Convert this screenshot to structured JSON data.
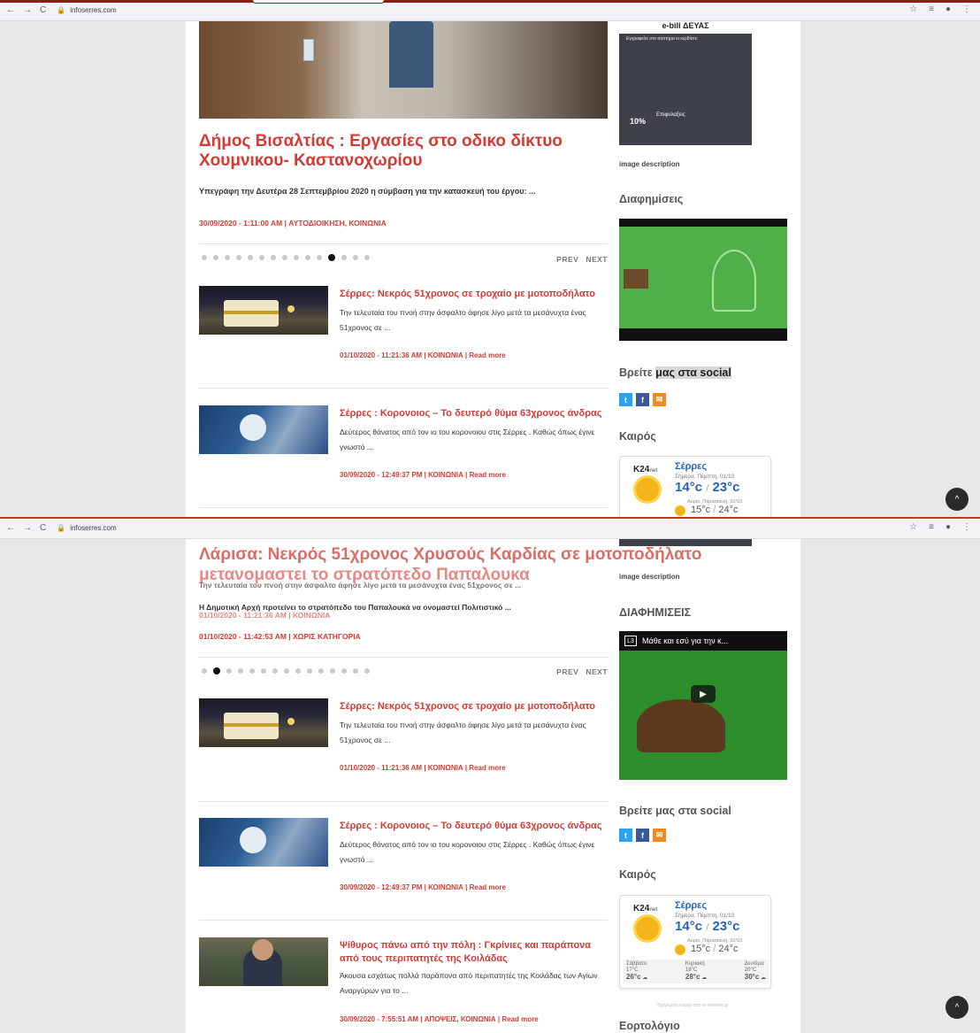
{
  "browser": {
    "url": "infoserres.com",
    "nav_back": "←",
    "nav_forward": "→",
    "nav_reload": "C",
    "lock": "🔒",
    "star": "☆",
    "reader": "≡",
    "account": "●",
    "menu": "⋮"
  },
  "shot1": {
    "lead": {
      "title": "Δήμος Βισαλτίας : Εργασίες στο οδικο δίκτυο Χουμνικου- Καστανοχωρίου",
      "summary": "Υπεγράφη την Δευτέρα 28 Σεπτεμβρίου 2020 η σύμβαση για την κατασκευή του έργου: ...",
      "meta": "30/09/2020 - 1:11:00 AM | ΑΥΤΟΔΙΟΙΚΗΣΗ, ΚΟΙΝΩΝΙΑ"
    },
    "slider": {
      "prev": "PREV",
      "next": "NEXT",
      "dot_count": 15,
      "active": 11
    },
    "items": [
      {
        "title": "Σέρρες: Νεκρός 51χρονος σε τροχαίο με μοτοποδήλατο",
        "summary": "Την τελευταία του πνοή στην άσφαλτο άφησε λίγο μετά τα μεσάνυχτα ένας 51χρονος σε ...",
        "meta": "01/10/2020 - 11:21:36 AM | ΚΟΙΝΩΝΙΑ | Read more"
      },
      {
        "title": "Σέρρες : Κορονοιος – Το δευτερό θύμα 63χρονος άνδρας",
        "summary": "Δεύτερος θάνατος από τον ιο του κορονοιου στις Σέρρες . Καθώς όπως έγινε γνωστό ...",
        "meta": "30/09/2020 - 12:49:37 PM | ΚΟΙΝΩΝΙΑ | Read more"
      }
    ],
    "sidebar": {
      "ebill_head": "e-bill ΔΕΥΑΣ",
      "ebill_sub": "Εγγραφείτε στο σύστημα κι κερδίστε:",
      "ebill_pct": "10%",
      "ebill_benefit": "Επιφυλαξεις",
      "image_description": "image description",
      "ads_heading": "Διαφημίσεις",
      "social_heading_a": "Βρείτε",
      "social_heading_b": "μας στα social",
      "weather_heading": "Καιρός"
    }
  },
  "shot2": {
    "ghost_a": "Λάρισα: Νεκρός 51χρονος Χρυσούς Καρδίας σε μοτοποδήλατο",
    "ghost_b": "μετανομαστει το στρατόπεδο Παπαλουκα",
    "ghost_c": "Την τελευταία του πνοή στην άσφαλτο άφησε λίγο μετά τα μεσάνυχτα ένας 51χρονος σε ...",
    "ghost_d": "Η Δημοτική Αρχή προτείνει το στρατόπεδο του Παπαλουκά να ονομαστεί Πολιτιστικό ...",
    "ghost_e": "01/10/2020 - 11:21:36 AM | ΚΟΙΝΩΝΙΑ",
    "ghost_meta": "01/10/2020 - 11:42:53 AM | ΧΩΡΙΣ ΚΑΤΗΓΟΡΙΑ",
    "slider": {
      "prev": "PREV",
      "next": "NEXT",
      "dot_count": 15,
      "active": 1
    },
    "items": [
      {
        "title": "Σέρρες: Νεκρός 51χρονος σε τροχαίο με μοτοποδήλατο",
        "summary": "Την τελευταία του πνοή στην άσφαλτο άφησε λίγο μετά τα μεσάνυχτα ένας 51χρονος σε ...",
        "meta": "01/10/2020 - 11:21:36 AM | ΚΟΙΝΩΝΙΑ | Read more"
      },
      {
        "title": "Σέρρες : Κορονοιος – Το δευτερό θύμα 63χρονος άνδρας",
        "summary": "Δεύτερος θάνατος από τον ιο του κορονοιου στις Σέρρες . Καθώς όπως έγινε γνωστό ...",
        "meta": "30/09/2020 - 12:49:37 PM | ΚΟΙΝΩΝΙΑ | Read more"
      },
      {
        "title": "Ψίθυρος πάνω από την πόλη : Γκρίνιες και παράπονα από τους περιπατητές της Κοιλάδας",
        "summary": "Άκουσα εσχάτως πολλά παράπονα από περιπατητές της Κοιλάδας των Αγίων Αναργύρων για το ...",
        "meta": "30/09/2020 - 7:55:51 AM | ΑΠΟΨΕΙΣ, ΚΟΙΝΩΝΙΑ | Read more"
      }
    ],
    "sidebar": {
      "image_description": "image description",
      "ads_heading": "ΔΙΑΦΗΜΙΣΕΙΣ",
      "video_title": "Μάθε και εσύ για την κ...",
      "video_logo": "L3",
      "social_heading": "Βρείτε μας στα social",
      "weather_heading": "Καιρός",
      "calendar_heading": "Εορτολόγιο",
      "weather_credit": "Πρόγνωση καιρού από το weather.gr"
    }
  },
  "social": {
    "twitter": "t",
    "facebook": "f",
    "email": "✉"
  },
  "weather": {
    "logo": "K24",
    "logo_suffix": "net",
    "city": "Σέρρες",
    "today_label": "Σήμερα, Πέμπτη, 01/10",
    "today_low": "14°c",
    "today_high": "23°c",
    "sep": "/",
    "tomorrow_label": "Αύριο, Παρασκευή, 02/10",
    "tomorrow_low": "15°c",
    "tomorrow_high": "24°c",
    "days": [
      {
        "name": "Σάββατο",
        "low": "17°C",
        "high": "26°c"
      },
      {
        "name": "Κυριακή",
        "low": "18°C",
        "high": "28°c"
      },
      {
        "name": "Δευτέρα",
        "low": "20°C",
        "high": "30°c"
      }
    ]
  },
  "ui": {
    "scroll_top": "^"
  }
}
